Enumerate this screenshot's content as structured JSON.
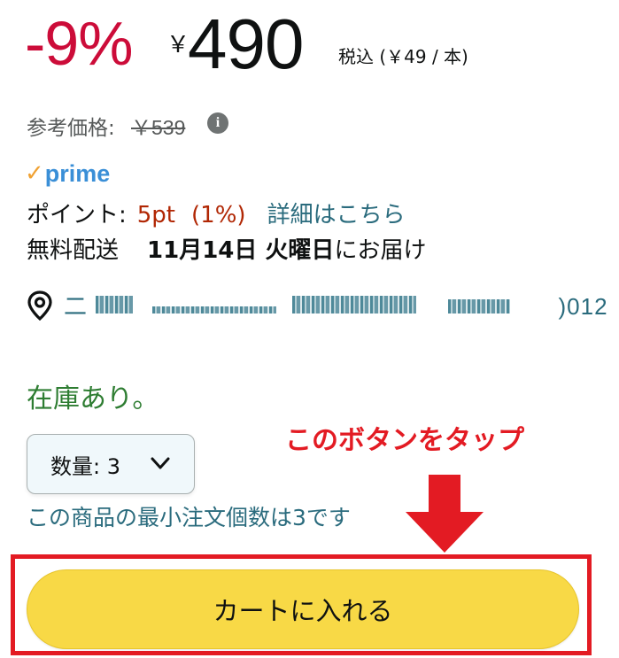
{
  "price": {
    "discount": "-9%",
    "currency_symbol": "￥",
    "amount": "490",
    "tax_info": "税込 (￥49 / 本)"
  },
  "reference": {
    "label": "参考価格:",
    "price": "￥539",
    "info_glyph": "i"
  },
  "prime": {
    "check": "✓",
    "word": "prime"
  },
  "points": {
    "label": "ポイント:",
    "value": "5pt",
    "percent": "(1%)",
    "details_link": "詳細はこちら"
  },
  "shipping": {
    "label": "無料配送",
    "date": "11月14日 火曜日",
    "suffix": "にお届け"
  },
  "location": {
    "visible_start": "二",
    "visible_end": ")012"
  },
  "stock": {
    "status": "在庫あり。"
  },
  "annotation": {
    "text": "このボタンをタップ",
    "color": "#e31b23"
  },
  "quantity": {
    "label": "数量: 3"
  },
  "min_order": {
    "text": "この商品の最小注文個数は3です"
  },
  "cart": {
    "button_label": "カートに入れる",
    "button_color": "#f8d946"
  }
}
